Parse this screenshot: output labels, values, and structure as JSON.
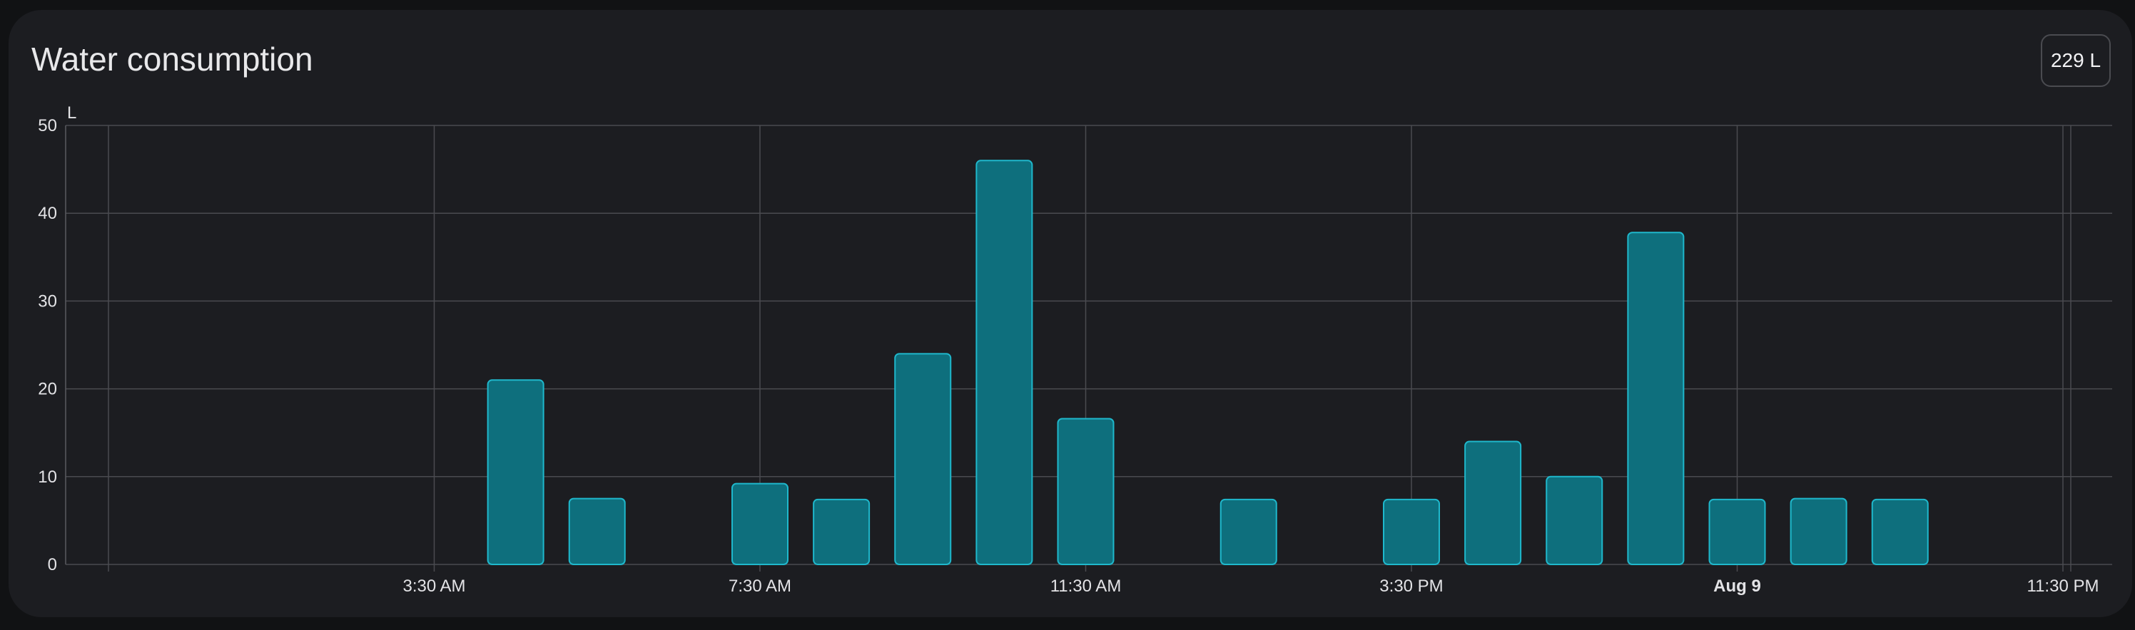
{
  "card": {
    "title": "Water consumption",
    "total": "229 L"
  },
  "chart_data": {
    "type": "bar",
    "unit_label": "L",
    "y_ticks": [
      0,
      10,
      20,
      30,
      40,
      50
    ],
    "ylim": [
      0,
      50
    ],
    "grid": true,
    "x_tick_labels": [
      "3:30 AM",
      "7:30 AM",
      "11:30 AM",
      "3:30 PM",
      "Aug 9",
      "11:30 PM"
    ],
    "bold_tick": "Aug 9",
    "x_tick_slots": [
      4,
      8,
      12,
      16,
      20,
      24
    ],
    "slot_count": 25,
    "series": [
      {
        "values": [
          {
            "slot": 5,
            "value": 21
          },
          {
            "slot": 6,
            "value": 7.5
          },
          {
            "slot": 8,
            "value": 9.2
          },
          {
            "slot": 9,
            "value": 7.4
          },
          {
            "slot": 10,
            "value": 24
          },
          {
            "slot": 11,
            "value": 46
          },
          {
            "slot": 12,
            "value": 16.6
          },
          {
            "slot": 14,
            "value": 7.4
          },
          {
            "slot": 16,
            "value": 7.4
          },
          {
            "slot": 17,
            "value": 14
          },
          {
            "slot": 18,
            "value": 10
          },
          {
            "slot": 19,
            "value": 37.8
          },
          {
            "slot": 20,
            "value": 7.4
          },
          {
            "slot": 21,
            "value": 7.5
          },
          {
            "slot": 22,
            "value": 7.4
          }
        ]
      }
    ],
    "colors": {
      "bar_fill": "#0e6f7d",
      "bar_stroke": "#1fb8cc",
      "grid": "#4a4b50",
      "axis": "#5a5b60"
    }
  }
}
